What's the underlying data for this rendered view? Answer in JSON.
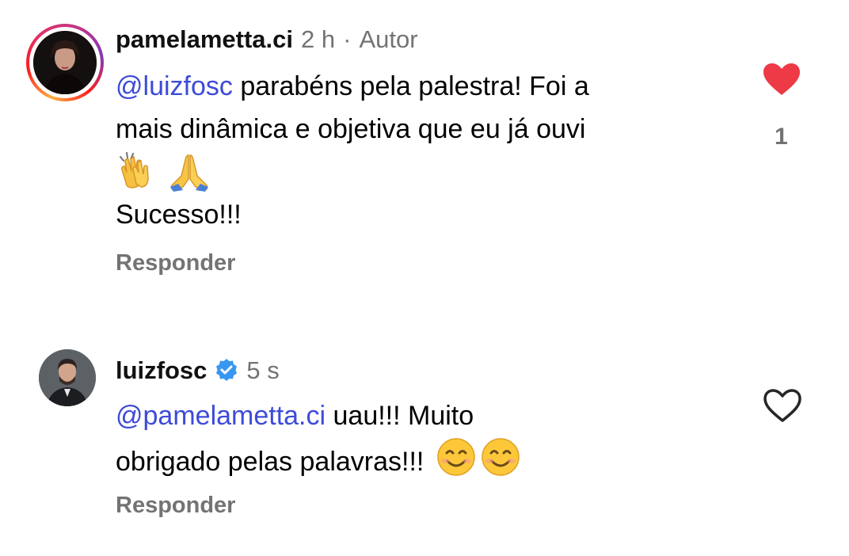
{
  "comments": [
    {
      "username": "pamelametta.ci",
      "time": "2 h",
      "separator": "·",
      "author_tag": "Autor",
      "mention": "@luizfosc",
      "text_line1": " parabéns pela palestra! Foi a",
      "text_line2": "mais dinâmica e objetiva que eu já ouvi",
      "emoji_1": "clapping-hands",
      "emoji_2": "folded-hands",
      "text_line4": "Sucesso!!!",
      "reply_label": "Responder",
      "liked": true,
      "like_count": "1",
      "has_story_ring": true
    },
    {
      "username": "luizfosc",
      "verified": true,
      "time": "5 s",
      "mention": "@pamelametta.ci",
      "text_line1": " uau!!! Muito",
      "text_line2": "obrigado pelas palavras!!! ",
      "emoji_1": "smiling-face",
      "emoji_2": "smiling-face",
      "reply_label": "Responder",
      "liked": false
    }
  ],
  "colors": {
    "mention": "#3d4bd8",
    "heart_filled": "#ed3a46",
    "meta_gray": "#737373",
    "verified_blue": "#3897f0"
  }
}
